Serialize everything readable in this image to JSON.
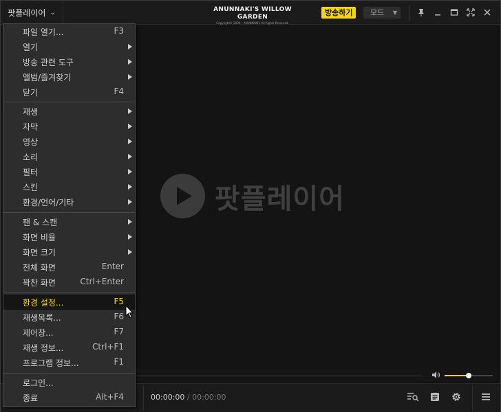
{
  "titlebar": {
    "app_menu_label": "팟플레이어",
    "banner_title": "ANUNNAKI'S WILLOW GARDEN",
    "banner_sub": "Copyright© 2004~ ANUNNAKI's All Rights Reserved.",
    "broadcast_label": "방송하기",
    "mode_label": "모드",
    "icons": [
      "pin-icon",
      "minimize-icon",
      "maximize-icon",
      "fullscreen-icon",
      "close-icon"
    ]
  },
  "video": {
    "logo_text": "팟플레이어"
  },
  "player": {
    "volume_level": 0.5
  },
  "controls": {
    "time_current": "00:00:00",
    "time_separator": "/",
    "time_total": "00:00:00",
    "icons": [
      "playlist-search-icon",
      "subtitle-icon",
      "settings-icon",
      "menu-icon"
    ]
  },
  "menu": {
    "items": [
      {
        "label": "파일 열기...",
        "shortcut": "F3",
        "submenu": false
      },
      {
        "label": "열기",
        "shortcut": "",
        "submenu": true
      },
      {
        "label": "방송 관련 도구",
        "shortcut": "",
        "submenu": true
      },
      {
        "label": "앨범/즐겨찾기",
        "shortcut": "",
        "submenu": true
      },
      {
        "label": "닫기",
        "shortcut": "F4",
        "submenu": false
      },
      {
        "label": "재생",
        "shortcut": "",
        "submenu": true
      },
      {
        "label": "자막",
        "shortcut": "",
        "submenu": true
      },
      {
        "label": "영상",
        "shortcut": "",
        "submenu": true
      },
      {
        "label": "소리",
        "shortcut": "",
        "submenu": true
      },
      {
        "label": "필터",
        "shortcut": "",
        "submenu": true
      },
      {
        "label": "스킨",
        "shortcut": "",
        "submenu": true
      },
      {
        "label": "환경/언어/기타",
        "shortcut": "",
        "submenu": true
      },
      {
        "label": "팬 & 스캔",
        "shortcut": "",
        "submenu": true
      },
      {
        "label": "화면 비율",
        "shortcut": "",
        "submenu": true
      },
      {
        "label": "화면 크기",
        "shortcut": "",
        "submenu": true
      },
      {
        "label": "전체 화면",
        "shortcut": "Enter",
        "submenu": false
      },
      {
        "label": "꽉찬 화면",
        "shortcut": "Ctrl+Enter",
        "submenu": false
      },
      {
        "label": "환경 설정...",
        "shortcut": "F5",
        "submenu": false,
        "highlighted": true
      },
      {
        "label": "재생목록...",
        "shortcut": "F6",
        "submenu": false
      },
      {
        "label": "제어창...",
        "shortcut": "F7",
        "submenu": false
      },
      {
        "label": "재생 정보...",
        "shortcut": "Ctrl+F1",
        "submenu": false
      },
      {
        "label": "프로그램 정보...",
        "shortcut": "F1",
        "submenu": false
      },
      {
        "label": "로그인...",
        "shortcut": "",
        "submenu": false
      },
      {
        "label": "종료",
        "shortcut": "Alt+F4",
        "submenu": false
      }
    ]
  },
  "colors": {
    "accent": "#f5d800",
    "menu_bg": "#2d2d2d",
    "window_bg": "#141414"
  }
}
